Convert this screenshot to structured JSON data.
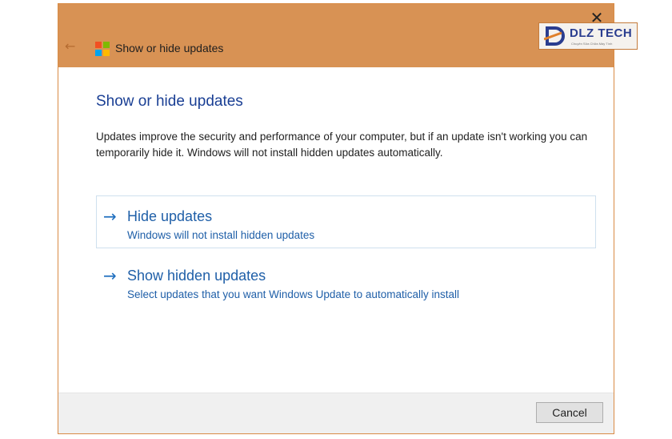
{
  "window": {
    "title": "Show or hide updates",
    "close_glyph": "✕",
    "back_glyph": "←"
  },
  "watermark": {
    "brand": "DLZ TECH",
    "tagline": "Chuyên Sửa Chữa Máy Tính"
  },
  "content": {
    "heading": "Show or hide updates",
    "description": "Updates improve the security and performance of your computer, but if an update isn't working you can temporarily hide it. Windows will not install hidden updates automatically."
  },
  "options": [
    {
      "arrow": "→",
      "title": "Hide updates",
      "subtitle": "Windows will not install hidden updates"
    },
    {
      "arrow": "→",
      "title": "Show hidden updates",
      "subtitle": "Select updates that you want Windows Update to automatically install"
    }
  ],
  "footer": {
    "cancel_label": "Cancel"
  },
  "colors": {
    "titlebar": "#d89254",
    "link_blue": "#1f5fa8",
    "heading_blue": "#1a3f94",
    "win_logo": [
      "#f25022",
      "#7fba00",
      "#00a4ef",
      "#ffb900"
    ]
  }
}
